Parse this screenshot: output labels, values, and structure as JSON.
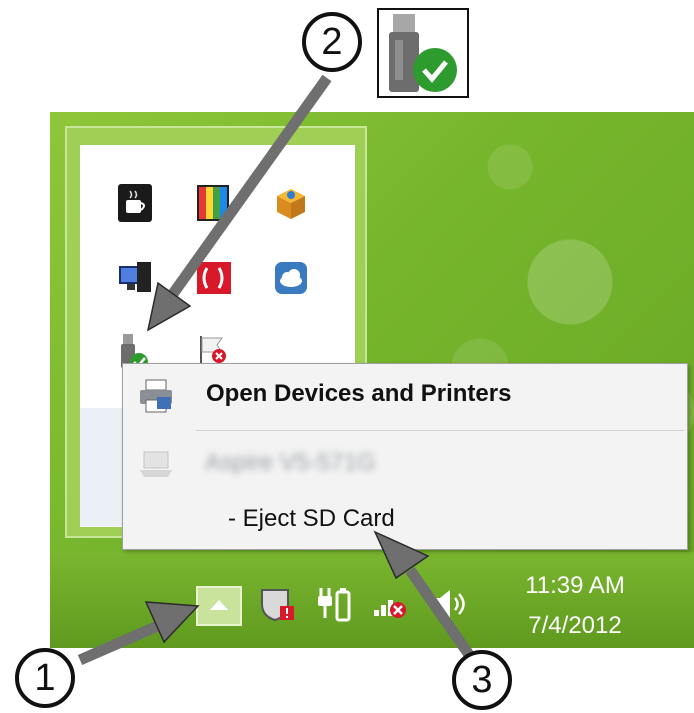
{
  "menu": {
    "open_devices_label": "Open Devices and Printers",
    "device_label_blurred": "Aspire V5-571G",
    "eject_label": "-   Eject SD Card"
  },
  "clock": {
    "time": "11:39 AM",
    "date": "7/4/2012"
  },
  "callouts": {
    "one": "1",
    "two": "2",
    "three": "3"
  },
  "colors": {
    "wallpaper_green": "#7ab62f",
    "flyout_border": "#c8e69a",
    "menu_background": "#f3f3f3",
    "arrow_gray": "#6f6f6f",
    "check_green": "#2e9b2e"
  },
  "icons": {
    "tray_row1": [
      "coffee-cup-icon",
      "color-palette-icon",
      "package-box-icon"
    ],
    "tray_row2": [
      "monitor-network-icon",
      "red-media-icon",
      "cloud-icon"
    ],
    "tray_row3": [
      "usb-safely-remove-icon",
      "action-center-flag-icon"
    ],
    "taskbar": [
      "show-hidden-icons-chevron-icon",
      "security-shield-icon",
      "power-plug-icon",
      "network-disconnected-icon",
      "volume-speaker-icon"
    ],
    "menu": [
      "printer-icon",
      "laptop-icon"
    ],
    "zoomed": "usb-safely-remove-icon"
  }
}
